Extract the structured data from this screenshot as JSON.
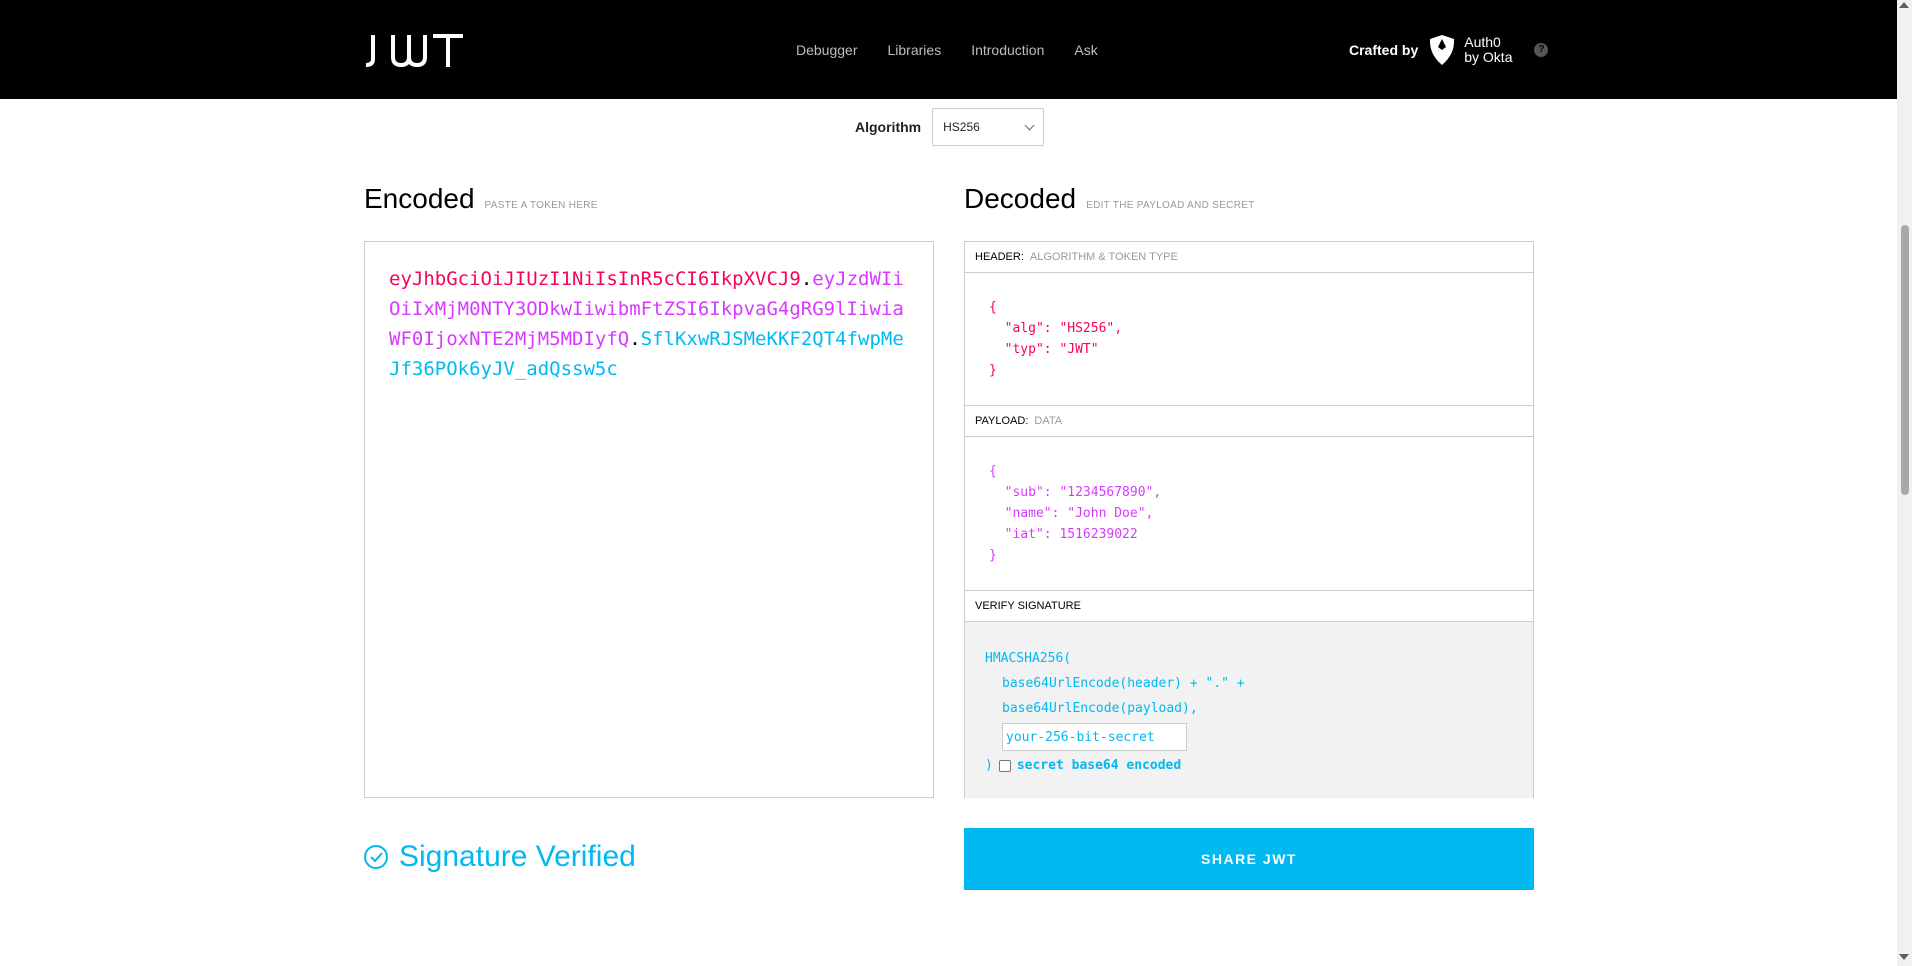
{
  "header": {
    "logo_text": "JWT",
    "nav": [
      "Debugger",
      "Libraries",
      "Introduction",
      "Ask"
    ],
    "crafted_label": "Crafted by",
    "brand_line1": "Auth0",
    "brand_line2": "by Okta",
    "help_glyph": "?"
  },
  "algorithm": {
    "label": "Algorithm",
    "selected": "HS256"
  },
  "encoded": {
    "title": "Encoded",
    "hint": "PASTE A TOKEN HERE",
    "header_part": "eyJhbGciOiJIUzI1NiIsInR5cCI6IkpXVCJ9",
    "payload_part": "eyJzdWIiOiIxMjM0NTY3ODkwIiwibmFtZSI6IkpvaG4gRG9lIiwiaWF0IjoxNTE2MjM5MDIyfQ",
    "signature_part": "SflKxwRJSMeKKF2QT4fwpMeJf36POk6yJV_adQssw5c",
    "dot": "."
  },
  "decoded": {
    "title": "Decoded",
    "hint": "EDIT THE PAYLOAD AND SECRET",
    "header_section": {
      "label": "HEADER:",
      "sublabel": "ALGORITHM & TOKEN TYPE"
    },
    "header_json": [
      "{",
      "  \"alg\": \"HS256\",",
      "  \"typ\": \"JWT\"",
      "}"
    ],
    "payload_section": {
      "label": "PAYLOAD:",
      "sublabel": "DATA"
    },
    "payload_json": [
      "{",
      "  \"sub\": \"1234567890\",",
      "  \"name\": \"John Doe\",",
      "  \"iat\": 1516239022",
      "}"
    ],
    "signature_section": {
      "label": "VERIFY SIGNATURE"
    },
    "signature": {
      "line1": "HMACSHA256(",
      "line2": "base64UrlEncode(header) + \".\" +",
      "line3": "base64UrlEncode(payload),",
      "secret_placeholder": "your-256-bit-secret",
      "close": ")",
      "checkbox_label": "secret base64 encoded"
    }
  },
  "status": {
    "verified_text": "Signature Verified"
  },
  "share_button": "SHARE JWT",
  "colors": {
    "header": "#fb015b",
    "payload": "#d63aff",
    "signature": "#00b9f1"
  }
}
